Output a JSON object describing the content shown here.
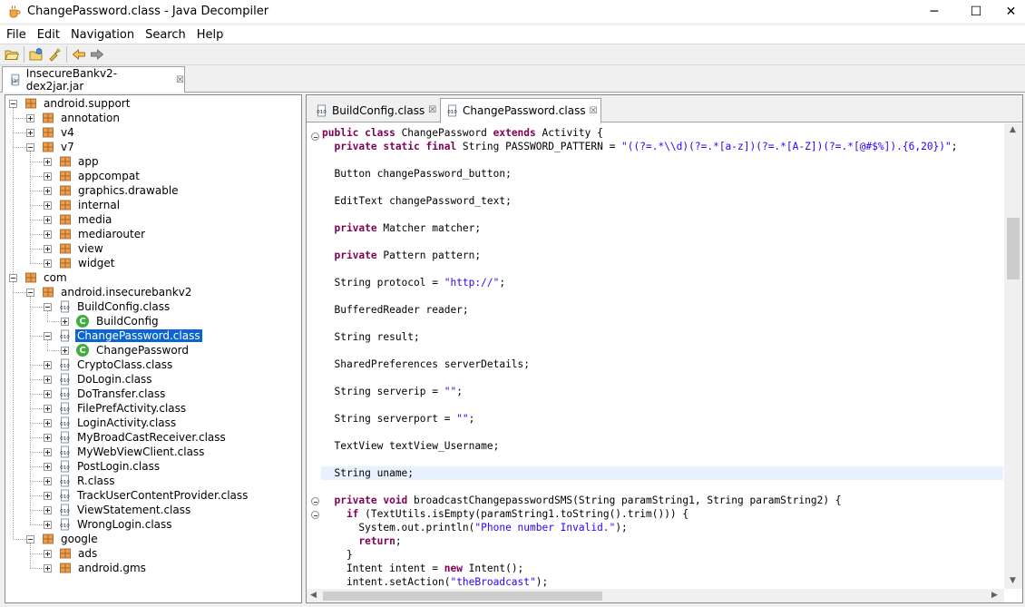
{
  "window": {
    "title": "ChangePassword.class - Java Decompiler",
    "minimize": "─",
    "maximize": "☐",
    "close": "✕"
  },
  "menu": [
    "File",
    "Edit",
    "Navigation",
    "Search",
    "Help"
  ],
  "file_tab": {
    "label": "InsecureBankv2-dex2jar.jar",
    "close": "☒"
  },
  "tree": [
    {
      "label": "android.support",
      "type": "package",
      "expander": "minus"
    },
    {
      "label": "annotation",
      "type": "package",
      "expander": "plus"
    },
    {
      "label": "v4",
      "type": "package",
      "expander": "plus"
    },
    {
      "label": "v7",
      "type": "package",
      "expander": "minus"
    },
    {
      "label": "app",
      "type": "package",
      "expander": "plus"
    },
    {
      "label": "appcompat",
      "type": "package",
      "expander": "plus"
    },
    {
      "label": "graphics.drawable",
      "type": "package",
      "expander": "plus"
    },
    {
      "label": "internal",
      "type": "package",
      "expander": "plus"
    },
    {
      "label": "media",
      "type": "package",
      "expander": "plus"
    },
    {
      "label": "mediarouter",
      "type": "package",
      "expander": "plus"
    },
    {
      "label": "view",
      "type": "package",
      "expander": "plus"
    },
    {
      "label": "widget",
      "type": "package",
      "expander": "plus"
    },
    {
      "label": "com",
      "type": "package",
      "expander": "minus"
    },
    {
      "label": "android.insecurebankv2",
      "type": "package",
      "expander": "minus"
    },
    {
      "label": "BuildConfig.class",
      "type": "classfile",
      "expander": "minus"
    },
    {
      "label": "BuildConfig",
      "type": "class",
      "expander": "plus"
    },
    {
      "label": "ChangePassword.class",
      "type": "classfile",
      "expander": "minus",
      "selected": true
    },
    {
      "label": "ChangePassword",
      "type": "class",
      "expander": "plus"
    },
    {
      "label": "CryptoClass.class",
      "type": "classfile",
      "expander": "plus"
    },
    {
      "label": "DoLogin.class",
      "type": "classfile",
      "expander": "plus"
    },
    {
      "label": "DoTransfer.class",
      "type": "classfile",
      "expander": "plus"
    },
    {
      "label": "FilePrefActivity.class",
      "type": "classfile",
      "expander": "plus"
    },
    {
      "label": "LoginActivity.class",
      "type": "classfile",
      "expander": "plus"
    },
    {
      "label": "MyBroadCastReceiver.class",
      "type": "classfile",
      "expander": "plus"
    },
    {
      "label": "MyWebViewClient.class",
      "type": "classfile",
      "expander": "plus"
    },
    {
      "label": "PostLogin.class",
      "type": "classfile",
      "expander": "plus"
    },
    {
      "label": "R.class",
      "type": "classfile",
      "expander": "plus"
    },
    {
      "label": "TrackUserContentProvider.class",
      "type": "classfile",
      "expander": "plus"
    },
    {
      "label": "ViewStatement.class",
      "type": "classfile",
      "expander": "plus"
    },
    {
      "label": "WrongLogin.class",
      "type": "classfile",
      "expander": "plus"
    },
    {
      "label": "google",
      "type": "package",
      "expander": "minus"
    },
    {
      "label": "ads",
      "type": "package",
      "expander": "plus"
    },
    {
      "label": "android.gms",
      "type": "package",
      "expander": "plus"
    }
  ],
  "editor_tabs": [
    {
      "label": "BuildConfig.class",
      "close": "☒",
      "active": false
    },
    {
      "label": "ChangePassword.class",
      "close": "☒",
      "active": true
    }
  ],
  "code_lines": [
    [
      {
        "t": "public class ",
        "k": 1
      },
      {
        "t": "ChangePassword "
      },
      {
        "t": "extends ",
        "k": 1
      },
      {
        "t": "Activity {"
      }
    ],
    [
      {
        "t": "  private static final ",
        "k": 1
      },
      {
        "t": "String PASSWORD_PATTERN = "
      },
      {
        "t": "\"((?=.*\\\\d)(?=.*[a-z])(?=.*[A-Z])(?=.*[@#$%]).{6,20})\"",
        "s": 1
      },
      {
        "t": ";"
      }
    ],
    [
      {
        "t": ""
      }
    ],
    [
      {
        "t": "  Button changePassword_button;"
      }
    ],
    [
      {
        "t": ""
      }
    ],
    [
      {
        "t": "  EditText changePassword_text;"
      }
    ],
    [
      {
        "t": ""
      }
    ],
    [
      {
        "t": "  private ",
        "k": 1
      },
      {
        "t": "Matcher matcher;"
      }
    ],
    [
      {
        "t": ""
      }
    ],
    [
      {
        "t": "  private ",
        "k": 1
      },
      {
        "t": "Pattern pattern;"
      }
    ],
    [
      {
        "t": ""
      }
    ],
    [
      {
        "t": "  String protocol = "
      },
      {
        "t": "\"http://\"",
        "s": 1
      },
      {
        "t": ";"
      }
    ],
    [
      {
        "t": ""
      }
    ],
    [
      {
        "t": "  BufferedReader reader;"
      }
    ],
    [
      {
        "t": ""
      }
    ],
    [
      {
        "t": "  String result;"
      }
    ],
    [
      {
        "t": ""
      }
    ],
    [
      {
        "t": "  SharedPreferences serverDetails;"
      }
    ],
    [
      {
        "t": ""
      }
    ],
    [
      {
        "t": "  String serverip = "
      },
      {
        "t": "\"\"",
        "s": 1
      },
      {
        "t": ";"
      }
    ],
    [
      {
        "t": ""
      }
    ],
    [
      {
        "t": "  String serverport = "
      },
      {
        "t": "\"\"",
        "s": 1
      },
      {
        "t": ";"
      }
    ],
    [
      {
        "t": ""
      }
    ],
    [
      {
        "t": "  TextView textView_Username;"
      }
    ],
    [
      {
        "t": ""
      }
    ],
    [
      {
        "t": "  String uname;"
      }
    ],
    [
      {
        "t": ""
      }
    ],
    [
      {
        "t": "  private void ",
        "k": 1
      },
      {
        "t": "broadcastChangepasswordSMS(String paramString1, String paramString2) {"
      }
    ],
    [
      {
        "t": "    if ",
        "k": 1
      },
      {
        "t": "(TextUtils.isEmpty(paramString1.toString().trim())) {"
      }
    ],
    [
      {
        "t": "      System.out.println("
      },
      {
        "t": "\"Phone number Invalid.\"",
        "s": 1
      },
      {
        "t": ");"
      }
    ],
    [
      {
        "t": "      return",
        "k": 1
      },
      {
        "t": ";"
      }
    ],
    [
      {
        "t": "    }"
      }
    ],
    [
      {
        "t": "    Intent intent = "
      },
      {
        "t": "new ",
        "k": 1
      },
      {
        "t": "Intent();"
      }
    ],
    [
      {
        "t": "    intent.setAction("
      },
      {
        "t": "\"theBroadcast\"",
        "s": 1
      },
      {
        "t": ");"
      }
    ]
  ],
  "colors": {
    "keyword": "#7f0055",
    "string": "#2a00ff",
    "selection": "#0a64d2",
    "current_line": "#e8f2fe"
  }
}
